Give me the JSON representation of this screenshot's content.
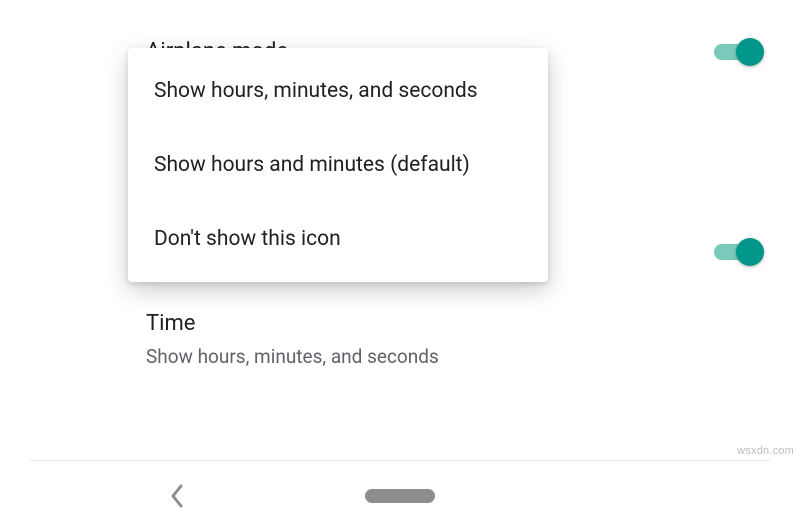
{
  "rows": {
    "airplane": {
      "title": "Airplane mode",
      "switch_on": true
    },
    "middle": {
      "switch_on": true
    },
    "time": {
      "title": "Time",
      "subtitle": "Show hours, minutes, and seconds"
    }
  },
  "dialog": {
    "options": [
      "Show hours, minutes, and seconds",
      "Show hours and minutes (default)",
      "Don't show this icon"
    ]
  },
  "colors": {
    "accent": "#009688",
    "accent_track": "#7ac9bc",
    "text_primary": "#202124",
    "text_secondary": "#5f6368"
  },
  "watermark": "wsxdn.com"
}
